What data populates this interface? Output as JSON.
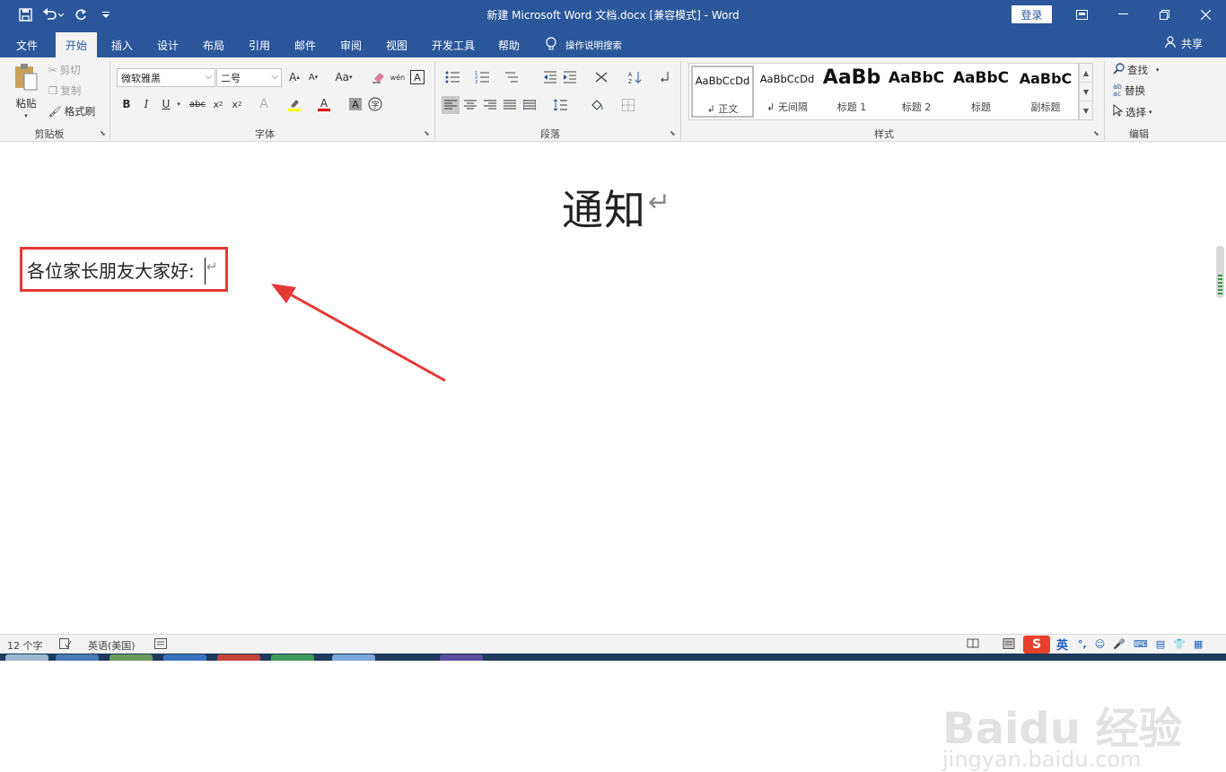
{
  "titlebar": {
    "doc_title": "新建 Microsoft Word 文档.docx [兼容模式] - Word",
    "login": "登录",
    "colors": {
      "brand": "#2b579a"
    }
  },
  "menu": {
    "tabs": [
      "文件",
      "开始",
      "插入",
      "设计",
      "布局",
      "引用",
      "邮件",
      "审阅",
      "视图",
      "开发工具",
      "帮助"
    ],
    "active": "开始",
    "tell_me": "操作说明搜索",
    "share": "共享"
  },
  "ribbon": {
    "clipboard": {
      "paste": "粘贴",
      "cut": "剪切",
      "copy": "复制",
      "format_painter": "格式刷",
      "label": "剪贴板"
    },
    "font": {
      "font_name": "微软雅黑",
      "font_size": "二号",
      "change_case": "Aa",
      "label": "字体"
    },
    "paragraph": {
      "label": "段落"
    },
    "styles": {
      "label": "样式",
      "items": [
        {
          "sample": "AaBbCcDd",
          "name": "↲ 正文"
        },
        {
          "sample": "AaBbCcDd",
          "name": "↲ 无间隔"
        },
        {
          "sample": "AaBb",
          "name": "标题 1"
        },
        {
          "sample": "AaBbC",
          "name": "标题 2"
        },
        {
          "sample": "AaBbC",
          "name": "标题"
        },
        {
          "sample": "AaBbC",
          "name": "副标题"
        }
      ]
    },
    "editing": {
      "find": "查找",
      "replace": "替换",
      "select": "选择",
      "label": "编辑"
    }
  },
  "document": {
    "heading": "通知",
    "heading_mark": "↵",
    "greeting": "各位家长朋友大家好:",
    "greeting_mark": "↵",
    "highlight_color": "#e53935"
  },
  "watermark": {
    "logo": "Baidu 经验",
    "url": "jingyan.baidu.com"
  },
  "statusbar": {
    "word_count": "12 个字",
    "language": "英语(美国)",
    "ime": "英"
  }
}
